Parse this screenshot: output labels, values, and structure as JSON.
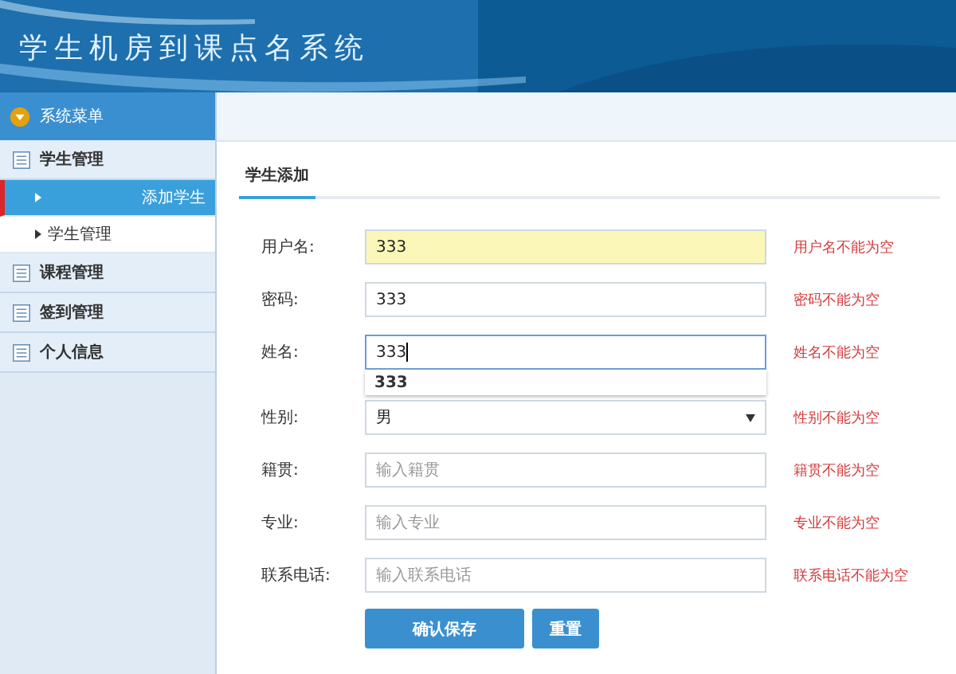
{
  "header": {
    "title": "学生机房到课点名系统"
  },
  "sidebar": {
    "title": "系统菜单",
    "groups": [
      {
        "label": "学生管理",
        "children": [
          {
            "label": "添加学生",
            "selected": true
          },
          {
            "label": "学生管理",
            "selected": false
          }
        ]
      },
      {
        "label": "课程管理"
      },
      {
        "label": "签到管理"
      },
      {
        "label": "个人信息"
      }
    ]
  },
  "tabs": [
    {
      "label": "学生添加",
      "selected": true
    }
  ],
  "form": {
    "fields": [
      {
        "kind": "input",
        "label": "用户名:",
        "value": "333",
        "autofilled": true,
        "focused": false,
        "error": "用户名不能为空"
      },
      {
        "kind": "input",
        "label": "密码:",
        "value": "333",
        "autofilled": false,
        "focused": false,
        "error": "密码不能为空"
      },
      {
        "kind": "input",
        "label": "姓名:",
        "value": "333",
        "autofilled": false,
        "focused": true,
        "suggestion": "333",
        "error": "姓名不能为空"
      },
      {
        "kind": "select",
        "label": "性别:",
        "value": "男",
        "error": "性别不能为空"
      },
      {
        "kind": "input",
        "label": "籍贯:",
        "placeholder": "输入籍贯",
        "autofilled": false,
        "focused": false,
        "error": "籍贯不能为空"
      },
      {
        "kind": "input",
        "label": "专业:",
        "placeholder": "输入专业",
        "autofilled": false,
        "focused": false,
        "error": "专业不能为空"
      },
      {
        "kind": "input",
        "label": "联系电话:",
        "placeholder": "输入联系电话",
        "autofilled": false,
        "focused": false,
        "error": "联系电话不能为空"
      }
    ],
    "buttons": [
      {
        "label": "确认保存",
        "kind": "primary"
      },
      {
        "label": "重置",
        "kind": "secondary"
      }
    ]
  }
}
